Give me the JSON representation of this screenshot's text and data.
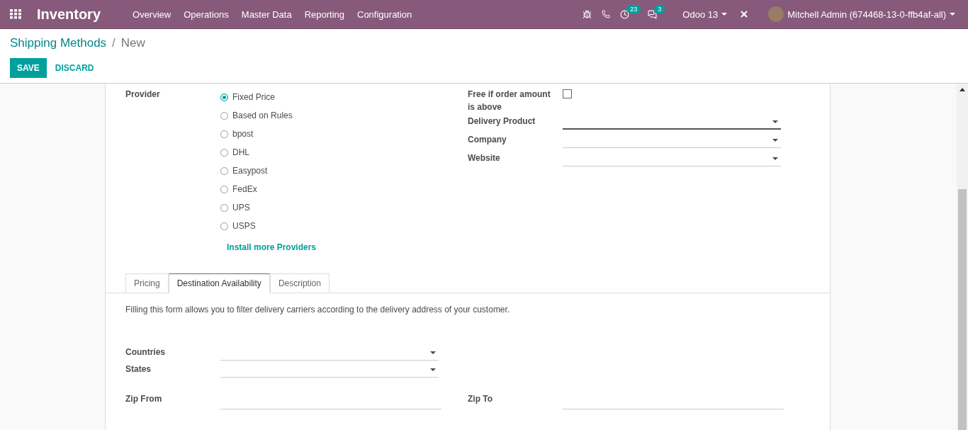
{
  "navbar": {
    "app_name": "Inventory",
    "menu": [
      "Overview",
      "Operations",
      "Master Data",
      "Reporting",
      "Configuration"
    ],
    "activity_count": "23",
    "message_count": "3",
    "database": "Odoo 13",
    "user": "Mitchell Admin (674468-13-0-ffb4af-all)"
  },
  "breadcrumb": {
    "parent": "Shipping Methods",
    "separator": "/",
    "current": "New"
  },
  "buttons": {
    "save": "SAVE",
    "discard": "DISCARD"
  },
  "provider": {
    "label": "Provider",
    "options": [
      {
        "label": "Fixed Price",
        "selected": true
      },
      {
        "label": "Based on Rules",
        "selected": false
      },
      {
        "label": "bpost",
        "selected": false
      },
      {
        "label": "DHL",
        "selected": false
      },
      {
        "label": "Easypost",
        "selected": false
      },
      {
        "label": "FedEx",
        "selected": false
      },
      {
        "label": "UPS",
        "selected": false
      },
      {
        "label": "USPS",
        "selected": false
      }
    ],
    "install_link": "Install more Providers"
  },
  "right_fields": [
    {
      "kind": "checkbox",
      "label": "Free if order amount is above",
      "checked": false
    },
    {
      "kind": "select",
      "label": "Delivery Product",
      "focused": true
    },
    {
      "kind": "select",
      "label": "Company",
      "focused": false
    },
    {
      "kind": "select",
      "label": "Website",
      "focused": false
    }
  ],
  "tabs": [
    {
      "label": "Pricing",
      "selected": false
    },
    {
      "label": "Destination Availability",
      "selected": true
    },
    {
      "label": "Description",
      "selected": false
    }
  ],
  "destination": {
    "note": "Filling this form allows you to filter delivery carriers according to the delivery address of your customer.",
    "selects": [
      {
        "label": "Countries"
      },
      {
        "label": "States"
      }
    ],
    "zip_from": "Zip From",
    "zip_to": "Zip To"
  }
}
